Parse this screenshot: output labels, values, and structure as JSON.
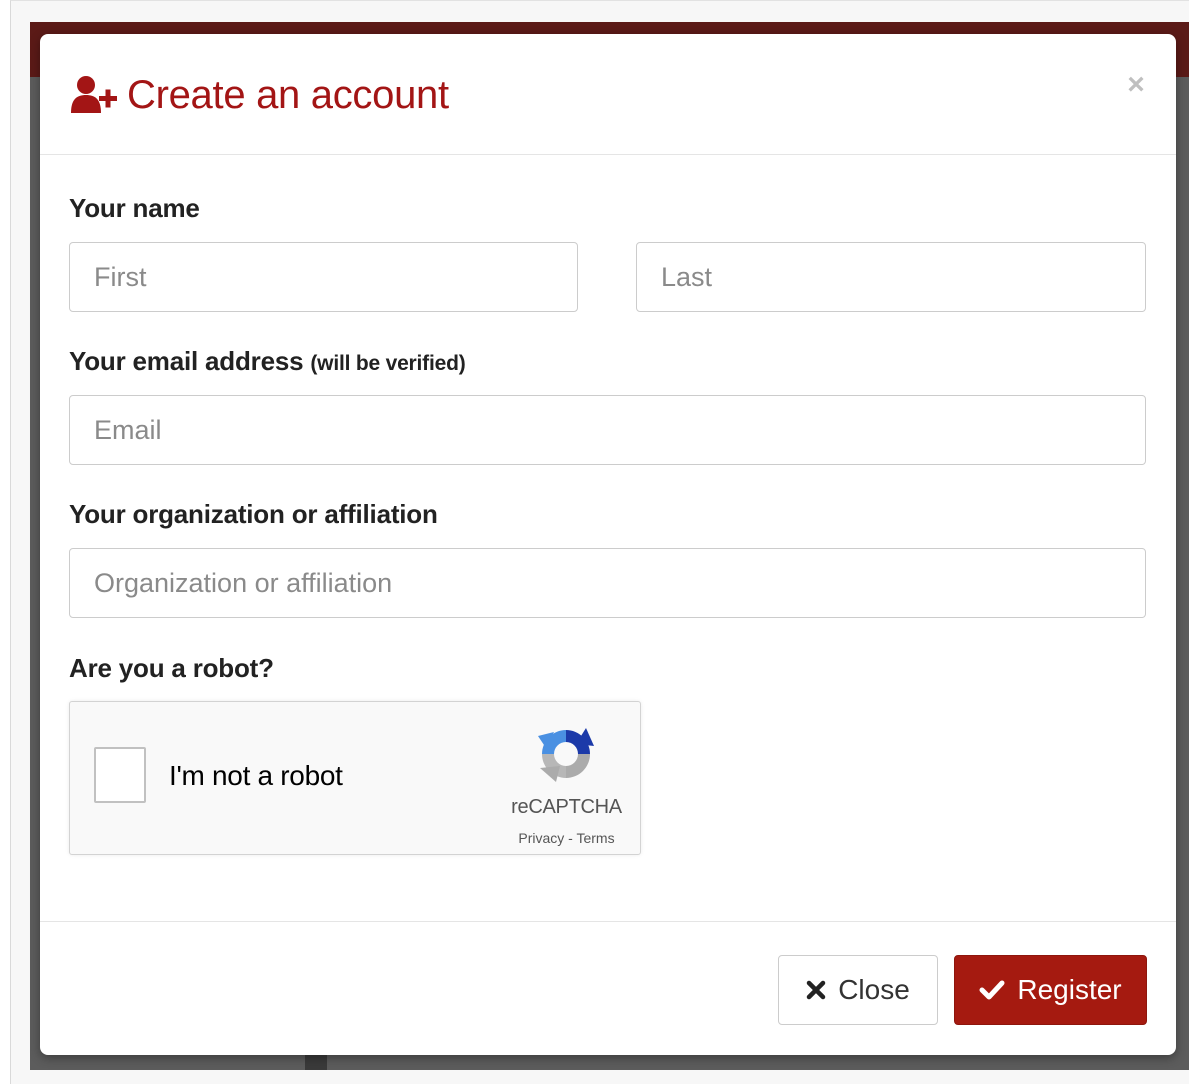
{
  "modal": {
    "title": "Create an account",
    "title_icon": "user-plus-icon",
    "close_glyph": "×"
  },
  "form": {
    "name_label": "Your name",
    "first_placeholder": "First",
    "last_placeholder": "Last",
    "email_label": "Your email address",
    "email_note": "(will be verified)",
    "email_placeholder": "Email",
    "org_label": "Your organization or affiliation",
    "org_placeholder": "Organization or affiliation",
    "robot_label": "Are you a robot?"
  },
  "recaptcha": {
    "checkbox_label": "I'm not a robot",
    "brand": "reCAPTCHA",
    "privacy": "Privacy",
    "separator": " - ",
    "terms": "Terms"
  },
  "footer": {
    "close_label": "Close",
    "close_icon": "times-icon",
    "register_label": "Register",
    "register_icon": "check-icon"
  },
  "colors": {
    "accent": "#a31515",
    "register_bg": "#a51a10"
  }
}
